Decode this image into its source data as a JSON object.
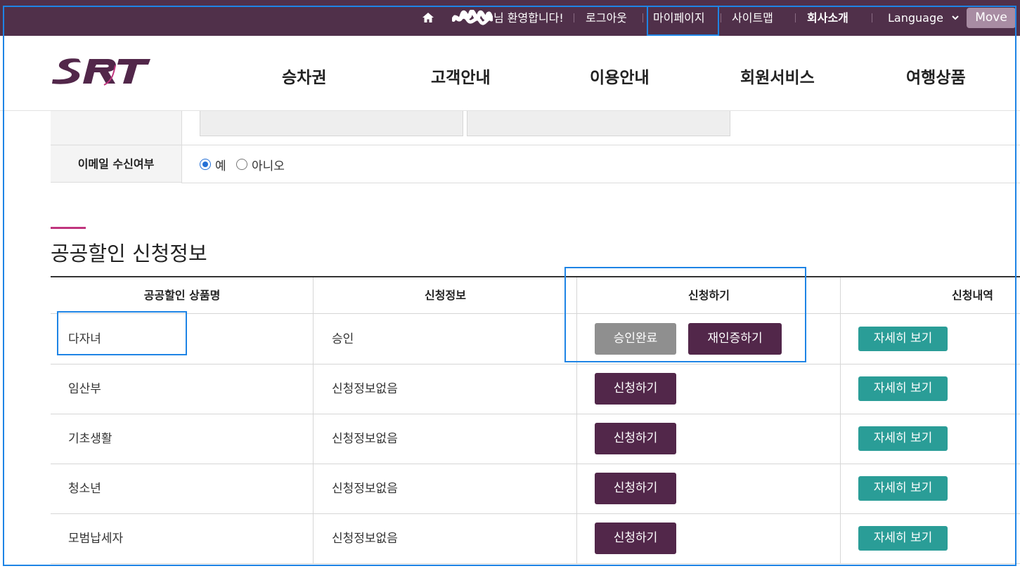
{
  "topbar": {
    "welcome": "님 환영합니다!",
    "logout": "로그아웃",
    "mypage": "마이페이지",
    "sitemap": "사이트맵",
    "company": "회사소개",
    "language": "Language",
    "move": "Move",
    "bg_color": "#50304a"
  },
  "header": {
    "logo_text": "SRT",
    "nav": [
      "승차권",
      "고객안내",
      "이용안내",
      "회원서비스",
      "여행상품"
    ]
  },
  "form": {
    "email_label": "이메일 수신여부",
    "options": [
      "예",
      "아니오"
    ],
    "selected": "예"
  },
  "section": {
    "title": "공공할인 신청정보"
  },
  "table": {
    "headers": [
      "공공할인 상품명",
      "신청정보",
      "신청하기",
      "신청내역"
    ],
    "rows": [
      {
        "name": "다자녀",
        "info": "승인",
        "buttons": [
          "승인완료",
          "재인증하기"
        ],
        "detail": "자세히 보기"
      },
      {
        "name": "임산부",
        "info": "신청정보없음",
        "buttons": [
          "신청하기"
        ],
        "detail": "자세히 보기"
      },
      {
        "name": "기초생활",
        "info": "신청정보없음",
        "buttons": [
          "신청하기"
        ],
        "detail": "자세히 보기"
      },
      {
        "name": "청소년",
        "info": "신청정보없음",
        "buttons": [
          "신청하기"
        ],
        "detail": "자세히 보기"
      },
      {
        "name": "모범납세자",
        "info": "신청정보없음",
        "buttons": [
          "신청하기"
        ],
        "detail": "자세히 보기"
      }
    ]
  },
  "colors": {
    "primary": "#52274a",
    "teal": "#2a9d97",
    "accent": "#c0357e",
    "highlight": "#1e84e5"
  },
  "icons": [
    "home-icon",
    "chevron-down-icon"
  ]
}
